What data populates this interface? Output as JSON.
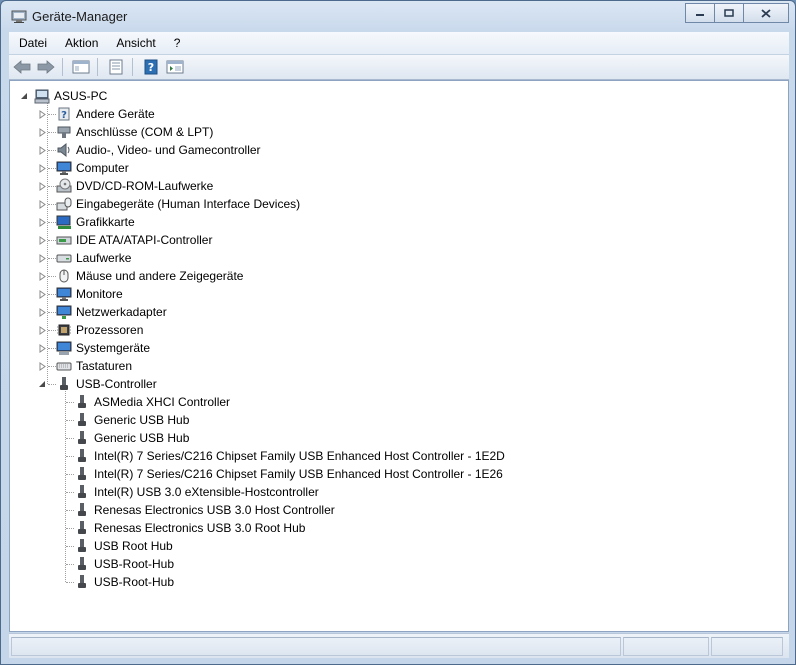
{
  "window": {
    "title": "Geräte-Manager",
    "minimize_icon": "minimize-icon",
    "maximize_icon": "maximize-icon",
    "close_icon": "close-icon"
  },
  "menu": [
    "Datei",
    "Aktion",
    "Ansicht",
    "?"
  ],
  "toolbar": [
    "back-arrow-icon",
    "forward-arrow-icon",
    "show-hide-tree-icon",
    "properties-icon",
    "help-icon",
    "console-tree-icon"
  ],
  "tree": {
    "root": {
      "label": "ASUS-PC",
      "icon": "computer-icon",
      "expanded": true
    },
    "categories": [
      {
        "label": "Andere Geräte",
        "icon": "unknown-device-icon",
        "expanded": false
      },
      {
        "label": "Anschlüsse (COM & LPT)",
        "icon": "port-icon",
        "expanded": false
      },
      {
        "label": "Audio-, Video- und Gamecontroller",
        "icon": "speaker-icon",
        "expanded": false
      },
      {
        "label": "Computer",
        "icon": "monitor-icon",
        "expanded": false
      },
      {
        "label": "DVD/CD-ROM-Laufwerke",
        "icon": "optical-drive-icon",
        "expanded": false
      },
      {
        "label": "Eingabegeräte (Human Interface Devices)",
        "icon": "hid-icon",
        "expanded": false
      },
      {
        "label": "Grafikkarte",
        "icon": "display-adapter-icon",
        "expanded": false
      },
      {
        "label": "IDE ATA/ATAPI-Controller",
        "icon": "ide-controller-icon",
        "expanded": false
      },
      {
        "label": "Laufwerke",
        "icon": "disk-drive-icon",
        "expanded": false
      },
      {
        "label": "Mäuse und andere Zeigegeräte",
        "icon": "mouse-icon",
        "expanded": false
      },
      {
        "label": "Monitore",
        "icon": "monitor-icon",
        "expanded": false
      },
      {
        "label": "Netzwerkadapter",
        "icon": "network-adapter-icon",
        "expanded": false
      },
      {
        "label": "Prozessoren",
        "icon": "processor-icon",
        "expanded": false
      },
      {
        "label": "Systemgeräte",
        "icon": "system-device-icon",
        "expanded": false
      },
      {
        "label": "Tastaturen",
        "icon": "keyboard-icon",
        "expanded": false
      },
      {
        "label": "USB-Controller",
        "icon": "usb-icon",
        "expanded": true
      }
    ],
    "usb_children": [
      "ASMedia XHCI Controller",
      "Generic USB Hub",
      "Generic USB Hub",
      "Intel(R) 7 Series/C216 Chipset Family USB Enhanced Host Controller - 1E2D",
      "Intel(R) 7 Series/C216 Chipset Family USB Enhanced Host Controller - 1E26",
      "Intel(R) USB 3.0 eXtensible-Hostcontroller",
      "Renesas Electronics USB 3.0 Host Controller",
      "Renesas Electronics USB 3.0 Root Hub",
      "USB Root Hub",
      "USB-Root-Hub",
      "USB-Root-Hub"
    ]
  },
  "colors": {
    "window_frame": "#c6d6ea",
    "content_bg": "#ffffff",
    "toolbar_blue": "#2d6fb3"
  }
}
